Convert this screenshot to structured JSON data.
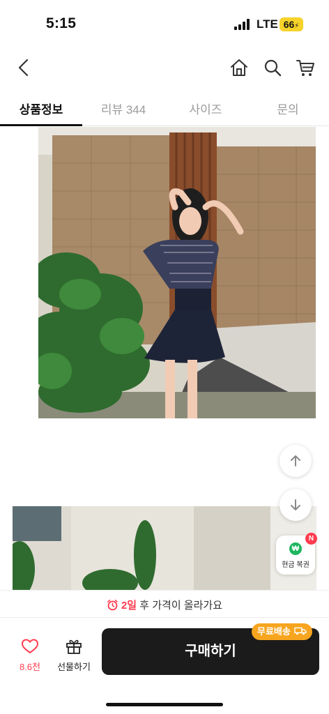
{
  "status_bar": {
    "time": "5:15",
    "network": "LTE",
    "battery": "66"
  },
  "nav": {
    "back_icon": "chevron-left-icon",
    "home_icon": "home-icon",
    "search_icon": "search-icon",
    "cart_icon": "cart-icon"
  },
  "tabs": [
    {
      "label": "상품정보",
      "active": true
    },
    {
      "label": "리뷰 344",
      "active": false
    },
    {
      "label": "사이즈",
      "active": false
    },
    {
      "label": "문의",
      "active": false
    }
  ],
  "floating": {
    "scroll_up_icon": "arrow-up-icon",
    "scroll_down_icon": "arrow-down-icon",
    "cashback_symbol": "₩",
    "cashback_label": "현금 복권",
    "cashback_badge": "N"
  },
  "notice": {
    "days": "2일",
    "text": " 후 가격이 올라가요"
  },
  "bottom_bar": {
    "like_count": "8.6천",
    "gift_label": "선물하기",
    "buy_label": "구매하기",
    "free_shipping": "무료배송"
  },
  "colors": {
    "accent_red": "#ff3b4e",
    "buy_button": "#1b1b1b",
    "shipping_badge": "#f7a51f",
    "cashback_green": "#1db55e"
  }
}
